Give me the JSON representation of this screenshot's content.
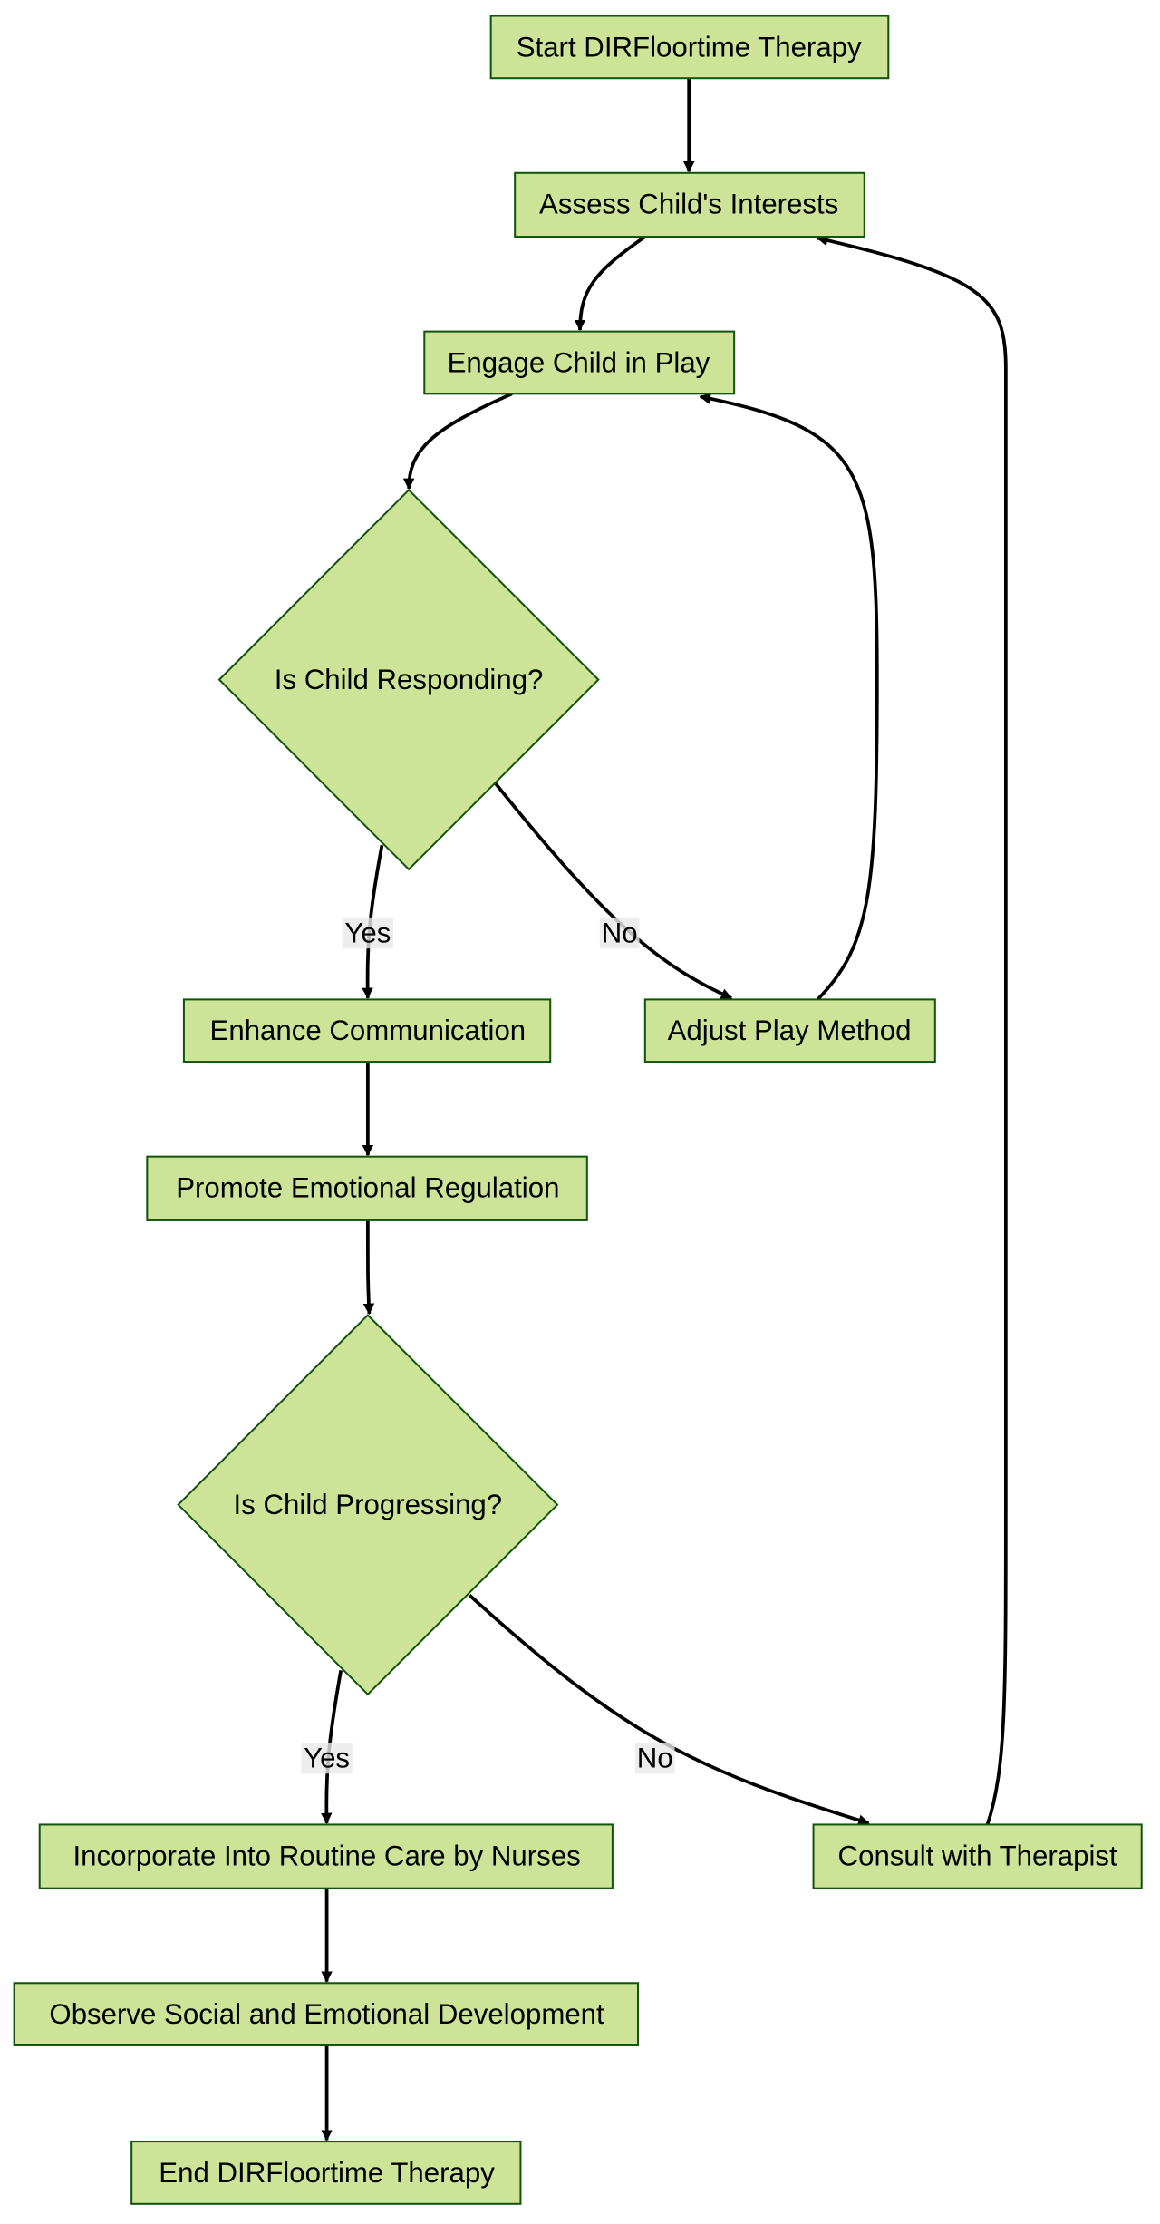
{
  "colors": {
    "node_fill": "#cde498",
    "node_stroke": "#13540c",
    "edge": "#000000",
    "label_bg": "#e8e8e8"
  },
  "nodes": {
    "start": "Start DIRFloortime Therapy",
    "assess": "Assess Child's Interests",
    "engage": "Engage Child in Play",
    "responding": "Is Child Responding?",
    "enhance": "Enhance Communication",
    "adjust": "Adjust Play Method",
    "promote": "Promote Emotional Regulation",
    "progressing": "Is Child Progressing?",
    "incorporate": "Incorporate Into Routine Care by Nurses",
    "consult": "Consult with Therapist",
    "observe": "Observe Social and Emotional Development",
    "end": "End DIRFloortime Therapy"
  },
  "edge_labels": {
    "responding_yes": "Yes",
    "responding_no": "No",
    "progressing_yes": "Yes",
    "progressing_no": "No"
  }
}
